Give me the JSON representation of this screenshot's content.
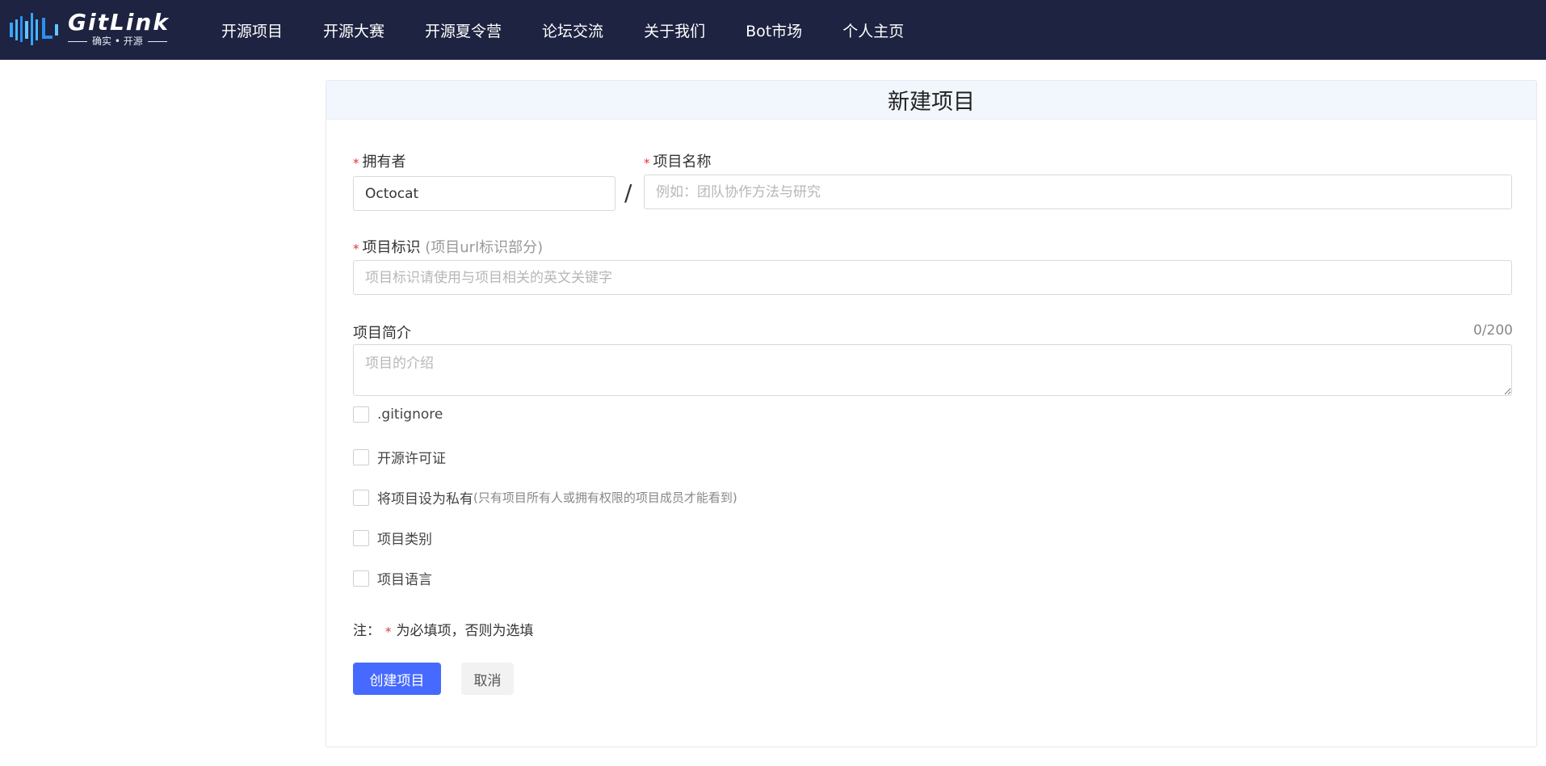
{
  "header": {
    "logo_text": "GitLink",
    "logo_subtitle": "确实 • 开源",
    "nav": [
      {
        "label": "开源项目"
      },
      {
        "label": "开源大赛"
      },
      {
        "label": "开源夏令营"
      },
      {
        "label": "论坛交流"
      },
      {
        "label": "关于我们"
      },
      {
        "label": "Bot市场"
      },
      {
        "label": "个人主页"
      }
    ]
  },
  "form": {
    "title": "新建项目",
    "required_mark": "*",
    "owner": {
      "label": "拥有者",
      "value": "Octocat"
    },
    "separator": "/",
    "project_name": {
      "label": "项目名称",
      "placeholder": "例如：团队协作方法与研究"
    },
    "identifier": {
      "label": "项目标识",
      "hint": "(项目url标识部分)",
      "placeholder": "项目标识请使用与项目相关的英文关键字"
    },
    "description": {
      "label": "项目简介",
      "counter": "0/200",
      "placeholder": "项目的介绍"
    },
    "options": [
      {
        "label": ".gitignore",
        "hint": "",
        "checked": false
      },
      {
        "label": "开源许可证",
        "hint": "",
        "checked": false
      },
      {
        "label": "将项目设为私有",
        "hint": "(只有项目所有人或拥有权限的项目成员才能看到)",
        "checked": false
      },
      {
        "label": "项目类别",
        "hint": "",
        "checked": false
      },
      {
        "label": "项目语言",
        "hint": "",
        "checked": false
      }
    ],
    "note_prefix": "注：",
    "note_suffix": "为必填项，否则为选填",
    "create_button": "创建项目",
    "cancel_button": "取消"
  },
  "colors": {
    "header_bg": "#1d2340",
    "primary": "#466aff",
    "required": "#e0353a",
    "card_head_bg": "#f1f7fd"
  }
}
